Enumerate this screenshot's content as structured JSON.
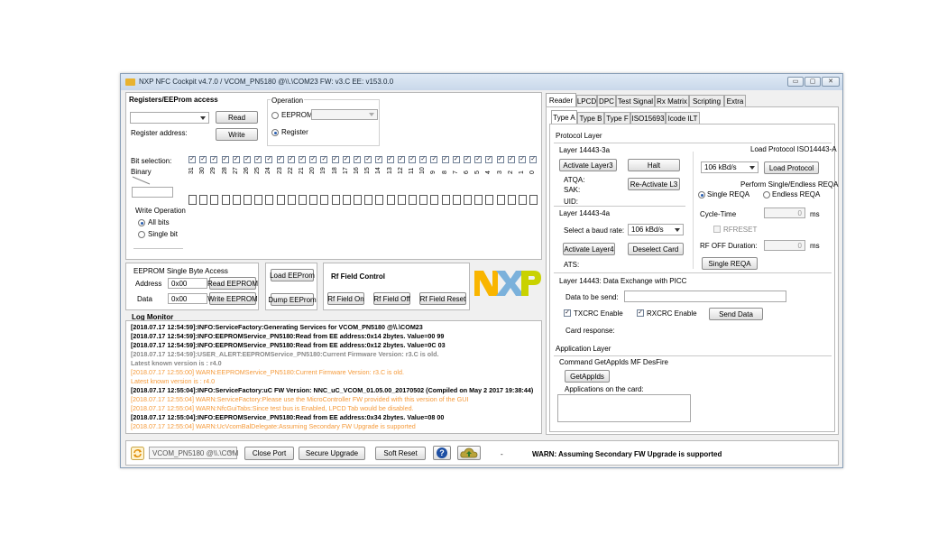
{
  "window": {
    "title": "NXP NFC Cockpit v4.7.0 / VCOM_PN5180 @\\\\.\\COM23  FW: v3.C  EE: v153.0.0",
    "buttons": {
      "minimize": "▭",
      "restore": "▢",
      "close": "✕"
    }
  },
  "registers": {
    "title": "Registers/EEProm access",
    "read_label": "Read",
    "write_label": "Write",
    "register_address_label": "Register address:",
    "operation_label": "Operation",
    "eeprom_label": "EEPROM",
    "register_label": "Register",
    "operation_selected": "Register",
    "bit_selection_label": "Bit selection:",
    "binary_label": "Binary",
    "bits": [
      "31",
      "30",
      "29",
      "28",
      "27",
      "26",
      "25",
      "24",
      "23",
      "22",
      "21",
      "20",
      "19",
      "18",
      "17",
      "16",
      "15",
      "14",
      "13",
      "12",
      "11",
      "10",
      "9",
      "8",
      "7",
      "6",
      "5",
      "4",
      "3",
      "2",
      "1",
      "0"
    ],
    "write_operation_label": "Write Operation",
    "all_bits_label": "All bits",
    "single_bit_label": "Single bit",
    "write_operation_selected": "All bits"
  },
  "eeprom_single": {
    "title": "EEPROM Single Byte Access",
    "address_label": "Address",
    "address_value": "0x00",
    "data_label": "Data",
    "data_value": "0x00",
    "read_label": "Read EEPROM",
    "write_label": "Write EEPROM"
  },
  "eeprom_file": {
    "load_label": "Load EEProm",
    "dump_label": "Dump EEProm"
  },
  "rf_field": {
    "title": "Rf Field Control",
    "on_label": "Rf Field On",
    "off_label": "Rf Field Off",
    "reset_label": "Rf Field Reset"
  },
  "logo": {
    "text": "NXP",
    "colors": {
      "n": "#f9b500",
      "x": "#7bb1db",
      "p": "#c9d200"
    }
  },
  "log": {
    "title": "Log Monitor",
    "lines": [
      {
        "text": "[2018.07.17 12:54:59]:INFO:ServiceFactory:Generating Services for VCOM_PN5180 @\\\\.\\COM23",
        "style": "bold"
      },
      {
        "text": "[2018.07.17 12:54:59]:INFO:EEPROMService_PN5180:Read from EE address:0x14 2bytes. Value=00 99",
        "style": "bold"
      },
      {
        "text": "[2018.07.17 12:54:59]:INFO:EEPROMService_PN5180:Read from EE address:0x12 2bytes. Value=0C 03",
        "style": "bold"
      },
      {
        "text": "[2018.07.17 12:54:59]:USER_ALERT:EEPROMService_PN5180:Current Firmware Version: r3.C is old.",
        "style": "grey"
      },
      {
        "text": "Latest known version is : r4.0",
        "style": "grey"
      },
      {
        "text": "[2018.07.17 12:55:00] WARN:EEPROMService_PN5180:Current Firmware Version: r3.C is old.",
        "style": "orange"
      },
      {
        "text": "Latest known version is : r4.0",
        "style": "orange"
      },
      {
        "text": "[2018.07.17 12:55:04]:INFO:ServiceFactory:uC FW Version: NNC_uC_VCOM_01.05.00_20170502 (Compiled on May  2 2017 19:38:44)",
        "style": "bold"
      },
      {
        "text": "[2018.07.17 12:55:04] WARN:ServiceFactory:Please use the MicroController FW provided with this version of the GUI",
        "style": "orange"
      },
      {
        "text": "[2018.07.17 12:55:04] WARN:NfcGuiTabs:Since test bus is Enabled, LPCD Tab would be disabled.",
        "style": "orange"
      },
      {
        "text": "[2018.07.17 12:55:04]:INFO:EEPROMService_PN5180:Read from EE address:0x34 2bytes. Value=08 00",
        "style": "bold"
      },
      {
        "text": "[2018.07.17 12:55:04] WARN:UcVcomBalDelegate:Assuming Secondary FW Upgrade is supported",
        "style": "orange"
      }
    ]
  },
  "tabs": {
    "main": [
      "Reader",
      "LPCD",
      "DPC",
      "Test Signal",
      "Rx Matrix",
      "Scripting",
      "Extra"
    ],
    "main_selected": "Reader",
    "sub": [
      "Type A",
      "Type B",
      "Type F",
      "ISO15693",
      "Icode ILT"
    ],
    "sub_selected": "Type A"
  },
  "type_a": {
    "protocol_layer_label": "Protocol Layer",
    "l3_title": "Layer 14443-3a",
    "activate_l3_label": "Activate Layer3",
    "halt_label": "Halt",
    "reactivate_l3_label": "Re-Activate L3",
    "atqa_label": "ATQA:",
    "sak_label": "SAK:",
    "uid_label": "UID:",
    "l4_title": "Layer 14443-4a",
    "baud_label": "Select a baud rate:",
    "baud_value": "106 kBd/s",
    "activate_l4_label": "Activate Layer4",
    "deselect_label": "Deselect Card",
    "ats_label": "ATS:",
    "load_protocol_title": "Load Protocol ISO14443-A",
    "load_protocol_baud": "106 kBd/s",
    "load_protocol_label": "Load Protocol",
    "reqa_title": "Perform Single/Endless REQA",
    "single_reqa_label": "Single REQA",
    "endless_reqa_label": "Endless REQA",
    "reqa_selected": "Single REQA",
    "cycle_time_label": "Cycle-Time",
    "cycle_time_value": "0",
    "ms_label": "ms",
    "rfreset_label": "RFRESET",
    "rf_off_label": "RF OFF Duration:",
    "rf_off_value": "0",
    "single_reqa_button": "Single REQA",
    "exchange_title": "Layer 14443: Data Exchange with PICC",
    "data_to_send_label": "Data to be send:",
    "txcrc_label": "TXCRC Enable",
    "rxcrc_label": "RXCRC Enable",
    "send_data_label": "Send Data",
    "card_response_label": "Card response:",
    "app_layer_label": "Application Layer",
    "getappids_title": "Command GetAppIds MF DesFire",
    "getappids_label": "GetAppIds",
    "apps_on_card_label": "Applications on the card:"
  },
  "statusbar": {
    "port_value": "VCOM_PN5180 @\\\\.\\COM",
    "close_port_label": "Close Port",
    "secure_upgrade_label": "Secure Upgrade",
    "soft_reset_label": "Soft Reset",
    "help_label": "?",
    "dash": "-",
    "message": "WARN: Assuming Secondary FW Upgrade is supported"
  }
}
